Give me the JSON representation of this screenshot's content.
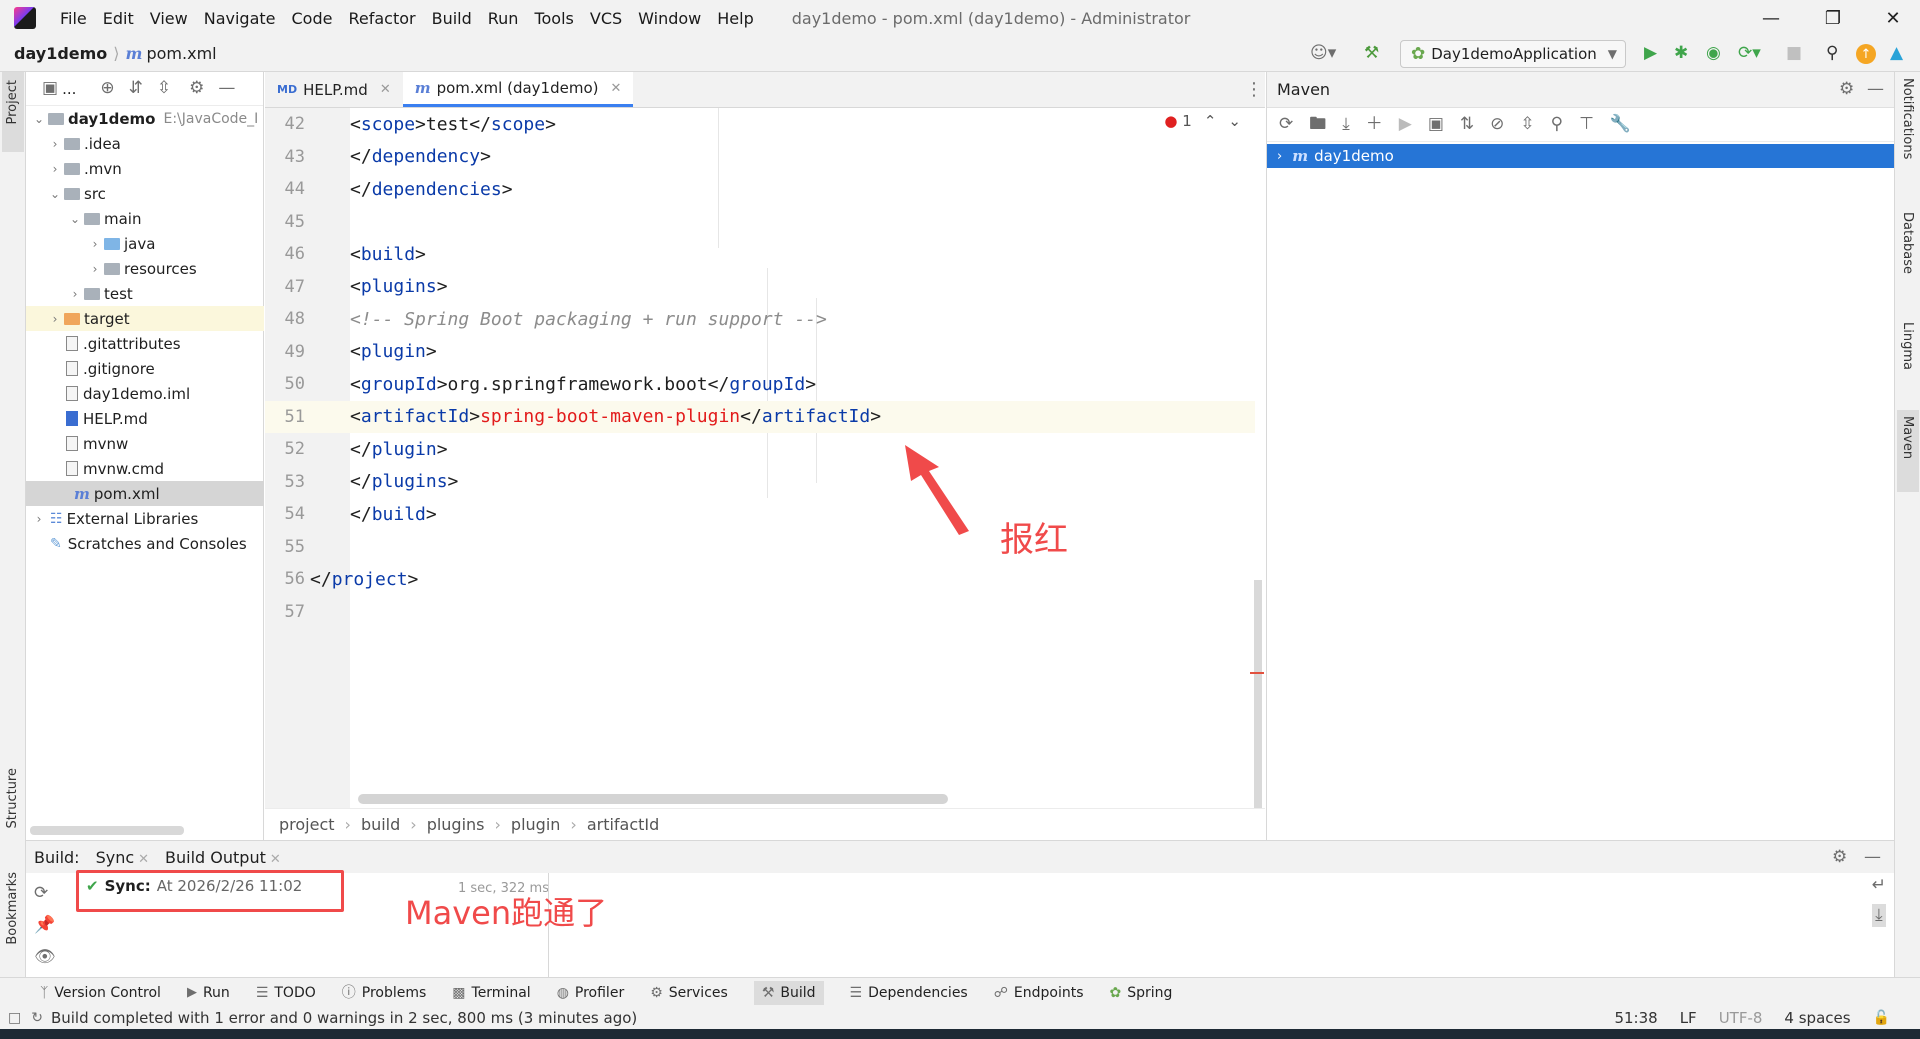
{
  "menu": {
    "items": [
      "File",
      "Edit",
      "View",
      "Navigate",
      "Code",
      "Refactor",
      "Build",
      "Run",
      "Tools",
      "VCS",
      "Window",
      "Help"
    ],
    "window_title": "day1demo - pom.xml (day1demo) - Administrator"
  },
  "navbar": {
    "project": "day1demo",
    "file": "pom.xml",
    "run_config": "Day1demoApplication"
  },
  "left_stripe": {
    "project_tab": "Project",
    "structure_tab": "Structure",
    "bookmarks_tab": "Bookmarks"
  },
  "project_panel": {
    "toolbar_label": "...",
    "tree": [
      {
        "label": "day1demo",
        "path": "E:\\JavaCode_I"
      },
      {
        "label": ".idea"
      },
      {
        "label": ".mvn"
      },
      {
        "label": "src"
      },
      {
        "label": "main"
      },
      {
        "label": "java"
      },
      {
        "label": "resources"
      },
      {
        "label": "test"
      },
      {
        "label": "target"
      },
      {
        "label": ".gitattributes"
      },
      {
        "label": ".gitignore"
      },
      {
        "label": "day1demo.iml"
      },
      {
        "label": "HELP.md"
      },
      {
        "label": "mvnw"
      },
      {
        "label": "mvnw.cmd"
      },
      {
        "label": "pom.xml"
      },
      {
        "label": "External Libraries"
      },
      {
        "label": "Scratches and Consoles"
      }
    ]
  },
  "editor": {
    "tabs": [
      {
        "label": "HELP.md"
      },
      {
        "label": "pom.xml (day1demo)"
      }
    ],
    "error_count": "1",
    "line_numbers": [
      "42",
      "43",
      "44",
      "45",
      "46",
      "47",
      "48",
      "49",
      "50",
      "51",
      "52",
      "53",
      "54",
      "55",
      "56",
      "57"
    ],
    "code": {
      "l42_open": "scope",
      "l42_text": "test",
      "l42_close": "scope",
      "l43_close": "dependency",
      "l44_close": "dependencies",
      "l46_open": "build",
      "l47_open": "plugins",
      "l48_comment": "<!-- Spring Boot packaging + run support -->",
      "l49_open": "plugin",
      "l50_open": "groupId",
      "l50_text": "org.springframework.boot",
      "l50_close": "groupId",
      "l51_open": "artifactId",
      "l51_text": "spring-boot-maven-plugin",
      "l51_close": "artifactId",
      "l52_close": "plugin",
      "l53_close": "plugins",
      "l54_close": "build",
      "l56_close": "project"
    },
    "breadcrumb": [
      "project",
      "build",
      "plugins",
      "plugin",
      "artifactId"
    ]
  },
  "maven": {
    "title": "Maven",
    "root": "day1demo"
  },
  "right_stripe": [
    "Notifications",
    "Database",
    "Lingma",
    "Maven"
  ],
  "build": {
    "label": "Build:",
    "tabs": [
      "Sync",
      "Build Output"
    ],
    "sync_label": "Sync:",
    "sync_text": "At 2026/2/26 11:02",
    "sync_time": "1 sec, 322 ms"
  },
  "tool_windows": [
    "Version Control",
    "Run",
    "TODO",
    "Problems",
    "Terminal",
    "Profiler",
    "Services",
    "Build",
    "Dependencies",
    "Endpoints",
    "Spring"
  ],
  "status": {
    "message": "Build completed with 1 error and 0 warnings in 2 sec, 800 ms (3 minutes ago)",
    "position": "51:38",
    "line_sep": "LF",
    "encoding": "UTF-8",
    "indent": "4 spaces"
  },
  "annotations": {
    "error_note": "报红",
    "maven_note": "Maven跑通了"
  },
  "colors": {
    "accent": "#2675d6",
    "error": "#e21b1b",
    "annotation": "#f04a4a",
    "tag": "#0a3aa8"
  }
}
